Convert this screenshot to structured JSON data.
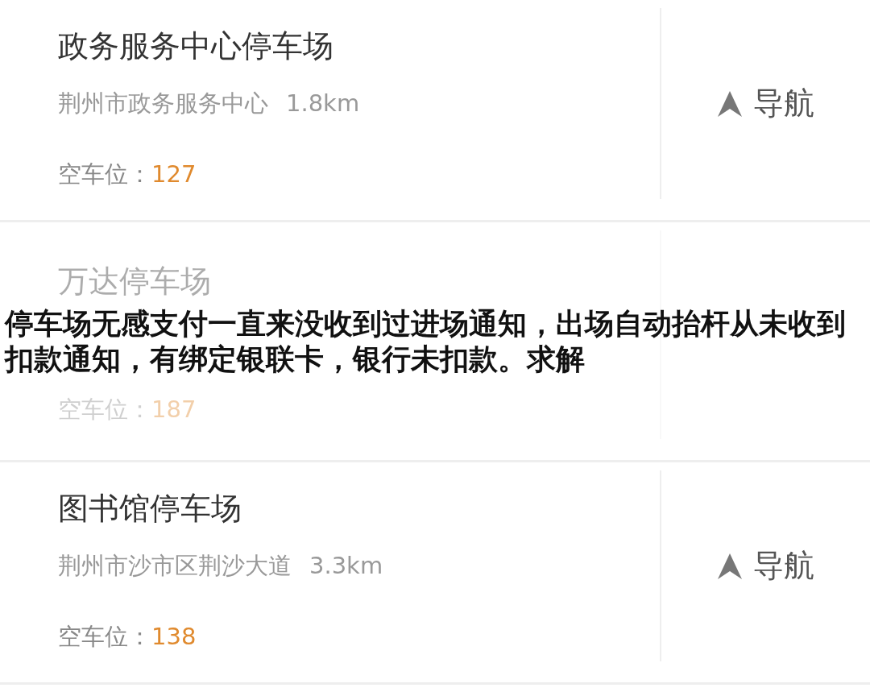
{
  "lots": [
    {
      "name": "政务服务中心停车场",
      "address": "荆州市政务服务中心",
      "distance": "1.8km",
      "spaces_label": "空车位：",
      "spaces": "127",
      "nav_label": "导航",
      "faded": false
    },
    {
      "name": "万达停车场",
      "spaces_label": "空车位：",
      "spaces": "187",
      "faded": true
    },
    {
      "name": "图书馆停车场",
      "address": "荆州市沙市区荆沙大道",
      "distance": "3.3km",
      "spaces_label": "空车位：",
      "spaces": "138",
      "nav_label": "导航",
      "faded": false
    }
  ],
  "caption": "停车场无感支付一直来没收到过进场通知，出场自动抬杆从未收到扣款通知，有绑定银联卡，银行未扣款。求解"
}
